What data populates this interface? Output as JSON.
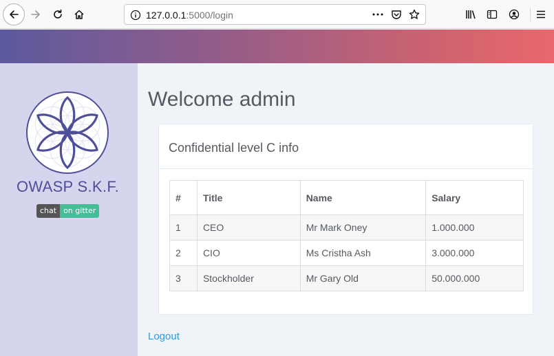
{
  "browser": {
    "url_host": "127.0.0.1",
    "url_rest": ":5000/login"
  },
  "sidebar": {
    "brand": "OWASP S.K.F.",
    "badge_left": "chat",
    "badge_right": "on gitter"
  },
  "main": {
    "title": "Welcome admin",
    "card_title": "Confidential level C info",
    "table": {
      "headers": [
        "#",
        "Title",
        "Name",
        "Salary"
      ],
      "rows": [
        [
          "1",
          "CEO",
          "Mr Mark Oney",
          "1.000.000"
        ],
        [
          "2",
          "CIO",
          "Ms Cristha Ash",
          "3.000.000"
        ],
        [
          "3",
          "Stockholder",
          "Mr Gary Old",
          "50.000.000"
        ]
      ]
    },
    "logout": "Logout"
  },
  "colors": {
    "sidebar_bg": "#d5d5ee",
    "brand": "#4e4e99",
    "link": "#2d9cdb",
    "gradient_start": "#5c5a9e",
    "gradient_end": "#e8676c"
  },
  "icons": [
    "back-arrow-icon",
    "forward-arrow-icon",
    "reload-icon",
    "home-icon",
    "info-icon",
    "more-dots-icon",
    "pocket-icon",
    "star-icon",
    "library-icon",
    "sidebar-icon",
    "account-icon",
    "menu-icon",
    "flower-of-life-logo"
  ]
}
